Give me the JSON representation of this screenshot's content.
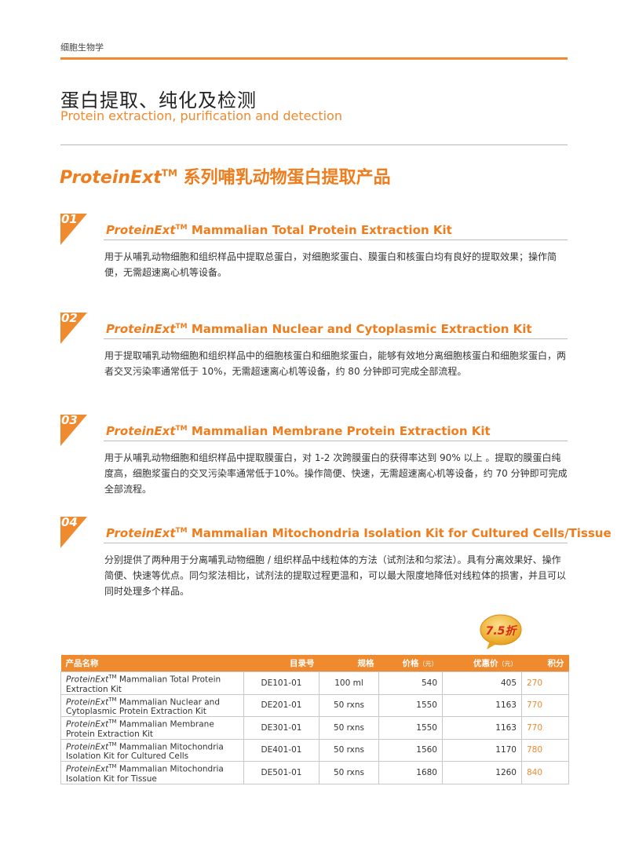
{
  "header": {
    "category": "细胞生物学"
  },
  "title": {
    "cn": "蛋白提取、纯化及检测",
    "en": "Protein extraction, purification and detection"
  },
  "section": {
    "brand": "ProteinExt",
    "tm": "TM",
    "heading_rest": " 系列哺乳动物蛋白提取产品"
  },
  "kits": [
    {
      "number": "01",
      "brand": "ProteinExt",
      "tm": "TM",
      "name": " Mammalian Total Protein Extraction Kit",
      "description": "用于从哺乳动物细胞和组织样品中提取总蛋白，对细胞浆蛋白、膜蛋白和核蛋白均有良好的提取效果；操作简便，无需超速离心机等设备。"
    },
    {
      "number": "02",
      "brand": "ProteinExt",
      "tm": "TM",
      "name": " Mammalian Nuclear and Cytoplasmic Extraction Kit",
      "description": "用于提取哺乳动物细胞和组织样品中的细胞核蛋白和细胞浆蛋白，能够有效地分离细胞核蛋白和细胞浆蛋白，两者交叉污染率通常低于 10%，无需超速离心机等设备，约 80 分钟即可完成全部流程。"
    },
    {
      "number": "03",
      "brand": "ProteinExt",
      "tm": "TM",
      "name": " Mammalian Membrane Protein Extraction Kit",
      "description": "用于从哺乳动物细胞和组织样品中提取膜蛋白，对 1-2 次跨膜蛋白的获得率达到 90% 以上 。提取的膜蛋白纯度高，细胞浆蛋白的交叉污染率通常低于10%。操作简便、快速，无需超速离心机等设备，约 70 分钟即可完成全部流程。"
    },
    {
      "number": "04",
      "brand": "ProteinExt",
      "tm": "TM",
      "name": " Mammalian Mitochondria Isolation Kit for Cultured Cells/Tissue",
      "description": "分别提供了两种用于分离哺乳动物细胞 / 组织样品中线粒体的方法（试剂法和匀浆法）。具有分离效果好、操作简便、快速等优点。同匀浆法相比，试剂法的提取过程更温和，可以最大限度地降低对线粒体的损害，并且可以同时处理多个样品。"
    }
  ],
  "badge": {
    "text": "7.5折"
  },
  "table": {
    "headers": {
      "name": "产品名称",
      "catalog": "目录号",
      "spec": "规格",
      "price": "价格",
      "price_unit": "（元）",
      "discount": "优惠价",
      "discount_unit": "（元）",
      "points": "积分"
    },
    "rows": [
      {
        "brand": "ProteinExt",
        "tm": "TM",
        "name_rest": " Mammalian Total Protein Extraction Kit",
        "catalog": "DE101-01",
        "spec": "100 ml",
        "price": "540",
        "discount": "405",
        "points": "270"
      },
      {
        "brand": "ProteinExt",
        "tm": "TM",
        "name_rest": " Mammalian Nuclear and Cytoplasmic Protein Extraction Kit",
        "catalog": "DE201-01",
        "spec": "50 rxns",
        "price": "1550",
        "discount": "1163",
        "points": "770"
      },
      {
        "brand": "ProteinExt",
        "tm": "TM",
        "name_rest": " Mammalian Membrane Protein Extraction Kit",
        "catalog": "DE301-01",
        "spec": "50 rxns",
        "price": "1550",
        "discount": "1163",
        "points": "770"
      },
      {
        "brand": "ProteinExt",
        "tm": "TM",
        "name_rest": " Mammalian Mitochondria Isolation Kit for Cultured Cells",
        "catalog": "DE401-01",
        "spec": "50 rxns",
        "price": "1560",
        "discount": "1170",
        "points": "780"
      },
      {
        "brand": "ProteinExt",
        "tm": "TM",
        "name_rest": " Mammalian Mitochondria Isolation Kit for Tissue",
        "catalog": "DE501-01",
        "spec": "50 rxns",
        "price": "1680",
        "discount": "1260",
        "points": "840"
      }
    ]
  },
  "colors": {
    "accent": "#ef8a2e",
    "heading": "#ef7d1e",
    "rule_gray": "#b8b8b8"
  }
}
